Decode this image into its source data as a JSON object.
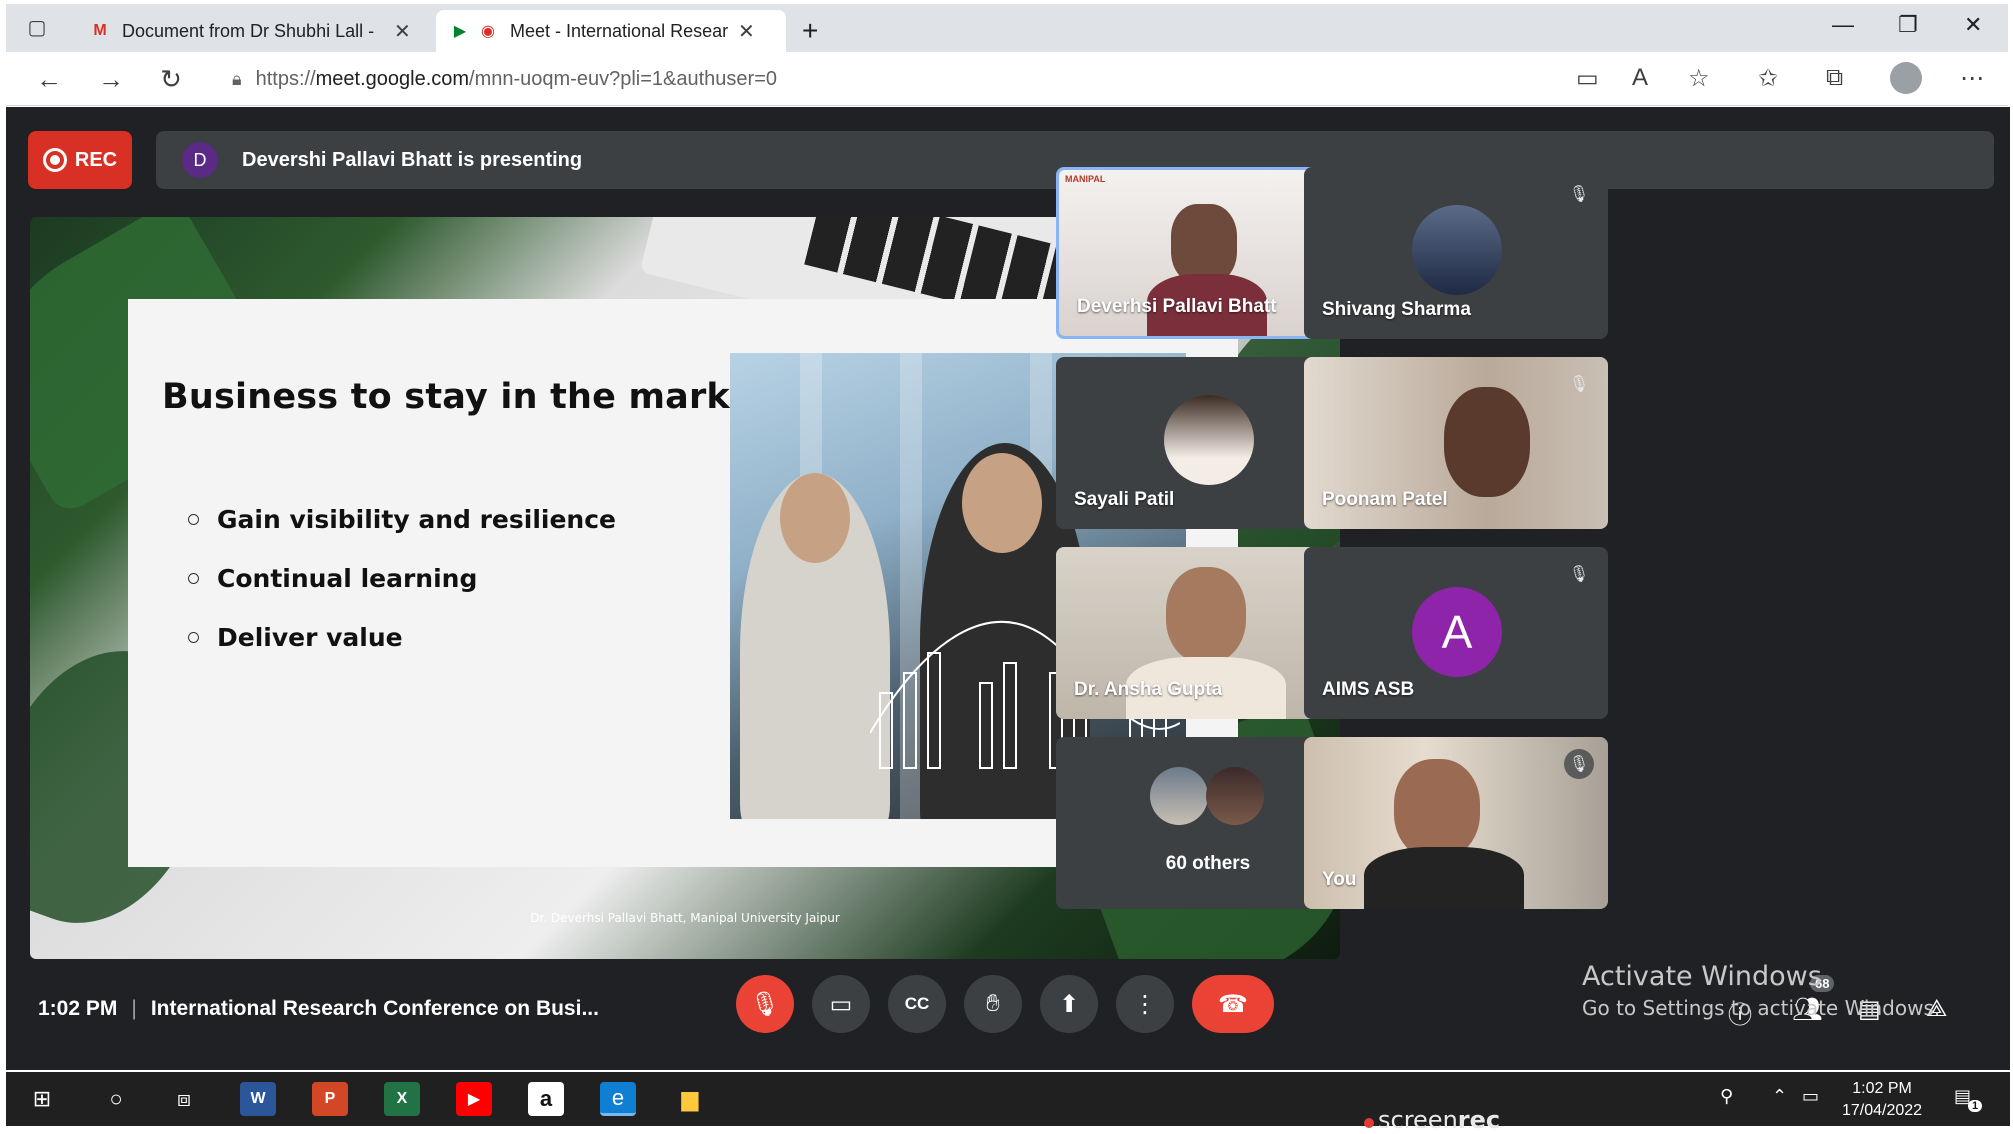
{
  "browser": {
    "tabs": [
      {
        "title": "Document from Dr Shubhi Lall -",
        "favicon": "gmail-icon",
        "active": false
      },
      {
        "title": "Meet - International Researc",
        "favicon": "meet-icon",
        "active": true
      }
    ],
    "url_scheme": "https://",
    "url_host": "meet.google.com",
    "url_path": "/mnn-uoqm-euv?pli=1&authuser=0"
  },
  "meet": {
    "rec_label": "REC",
    "presenter_initial": "D",
    "presenting_text": "Devershi Pallavi Bhatt is presenting",
    "slide": {
      "title": "Business to stay in the market",
      "bullets": [
        "Gain visibility and resilience",
        "Continual learning",
        "Deliver value"
      ],
      "footer": "Dr. Deverhsi Pallavi Bhatt, Manipal University Jaipur",
      "logo_text": "MANIPAL"
    },
    "participants": [
      {
        "name": "Deverhsi Pallavi Bhatt",
        "speaking": true
      },
      {
        "name": "Shivang Sharma",
        "muted": true
      },
      {
        "name": "Sayali Patil",
        "muted": true
      },
      {
        "name": "Poonam Patel",
        "muted": true
      },
      {
        "name": "Dr. Ansha Gupta",
        "muted": true
      },
      {
        "name": "AIMS ASB",
        "initial": "A",
        "avatar_color": "#8e24aa",
        "muted": true
      },
      {
        "name": "60 others"
      },
      {
        "name": "You",
        "muted": true
      }
    ],
    "time": "1:02 PM",
    "separator": "|",
    "meeting_title": "International Research Conference on Busi...",
    "people_count": "68",
    "watermark_line1": "Activate Windows",
    "watermark_line2": "Go to Settings to activate Windows."
  },
  "taskbar": {
    "clock_time": "1:02 PM",
    "clock_date": "17/04/2022",
    "notification_count": "1",
    "screenrec_prefix": "screen",
    "screenrec_suffix": "rec"
  },
  "colors": {
    "meet_bg": "#202124",
    "tile_bg": "#3c4043",
    "rec_red": "#d93025",
    "end_call_red": "#ea4335",
    "speaking_blue": "#1a73e8"
  }
}
